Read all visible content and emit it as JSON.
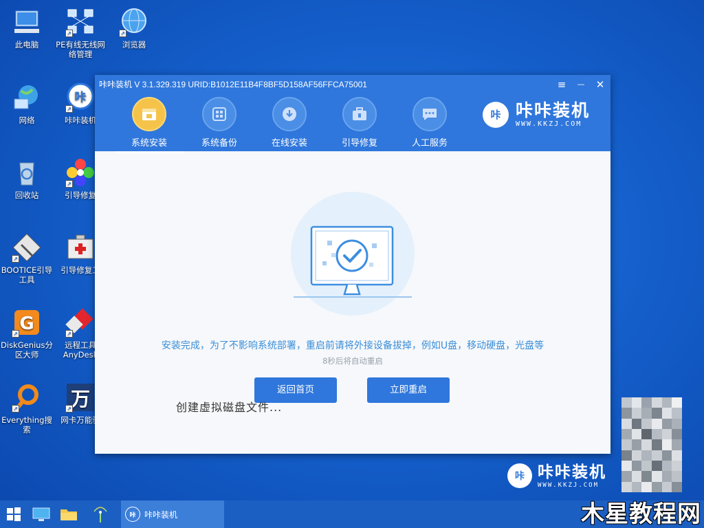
{
  "desktop": {
    "icons": [
      {
        "label": "此电脑",
        "glyph": "▭"
      },
      {
        "label": "PE有线无线网络管理",
        "glyph": "▦"
      },
      {
        "label": "浏览器",
        "glyph": "◉"
      },
      {
        "label": "网络",
        "glyph": "◍"
      },
      {
        "label": "咔咔装机",
        "glyph": "咔"
      },
      {
        "label": "回收站",
        "glyph": "♻"
      },
      {
        "label": "引导修复",
        "glyph": "✿"
      },
      {
        "label": "BOOTICE引导工具",
        "glyph": "▤"
      },
      {
        "label": "引导修复工",
        "glyph": "✚"
      },
      {
        "label": "DiskGenius分区大师",
        "glyph": "G"
      },
      {
        "label": "远程工具AnyDesk",
        "glyph": "◆"
      },
      {
        "label": "Everything搜索",
        "glyph": "○"
      },
      {
        "label": "网卡万能驱",
        "glyph": "万"
      }
    ]
  },
  "app": {
    "title": "咔咔装机 V 3.1.329.319 URID:B1012E11B4F8BF5D158AF56FFCA75001",
    "controls": {
      "menu": "≡",
      "minimize": "—",
      "close": "✕"
    },
    "nav": [
      {
        "label": "系统安装",
        "icon": "install-icon",
        "active": true
      },
      {
        "label": "系统备份",
        "icon": "backup-icon",
        "active": false
      },
      {
        "label": "在线安装",
        "icon": "download-icon",
        "active": false
      },
      {
        "label": "引导修复",
        "icon": "toolbox-icon",
        "active": false
      },
      {
        "label": "人工服务",
        "icon": "chat-icon",
        "active": false
      }
    ],
    "brand": {
      "logo": "咔",
      "name": "咔咔装机",
      "url": "WWW.KKZJ.COM"
    },
    "content": {
      "message": "安装完成，为了不影响系统部署，重启前请将外接设备拔掉，例如U盘，移动硬盘，光盘等",
      "countdown": "8秒后将自动重启",
      "btn_home": "返回首页",
      "btn_restart": "立即重启",
      "overlay": "创建虚拟磁盘文件..."
    }
  },
  "watermark": {
    "logo": "咔",
    "name": "咔咔装机",
    "url": "WWW.KKZJ.COM"
  },
  "taskbar": {
    "app_label": "咔咔装机",
    "app_logo": "咔"
  },
  "corner_watermark": "木星教程网",
  "colors": {
    "accent": "#2f77dc",
    "active_nav": "#f5c34a",
    "message": "#3a8ed8"
  }
}
